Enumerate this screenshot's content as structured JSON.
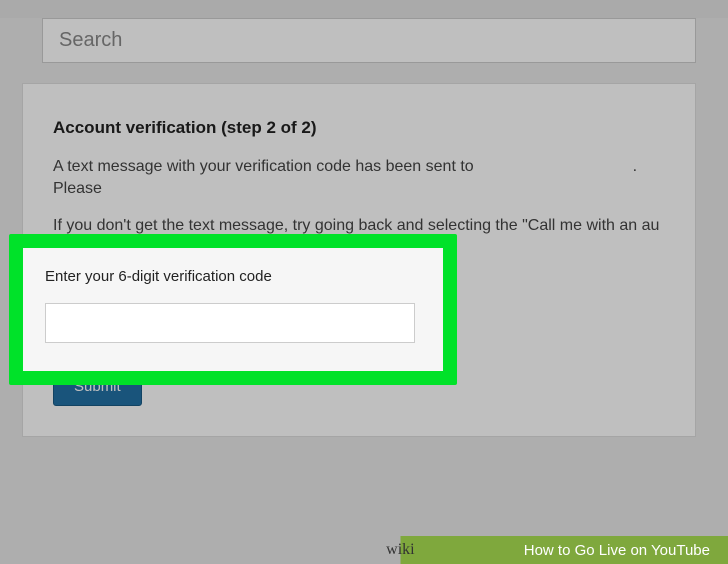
{
  "search": {
    "placeholder": "Search"
  },
  "card": {
    "title": "Account verification (step 2 of 2)",
    "line1_a": "A text message with your verification code has been sent to",
    "line1_b": ". Please",
    "line2": "If you don't get the text message, try going back and selecting the \"Call me with an au"
  },
  "highlight": {
    "label": "Enter your 6-digit verification code",
    "input_value": ""
  },
  "submit": {
    "label": "Submit"
  },
  "footer": {
    "logo_prefix": "wiki",
    "title": "How to Go Live on YouTube"
  }
}
